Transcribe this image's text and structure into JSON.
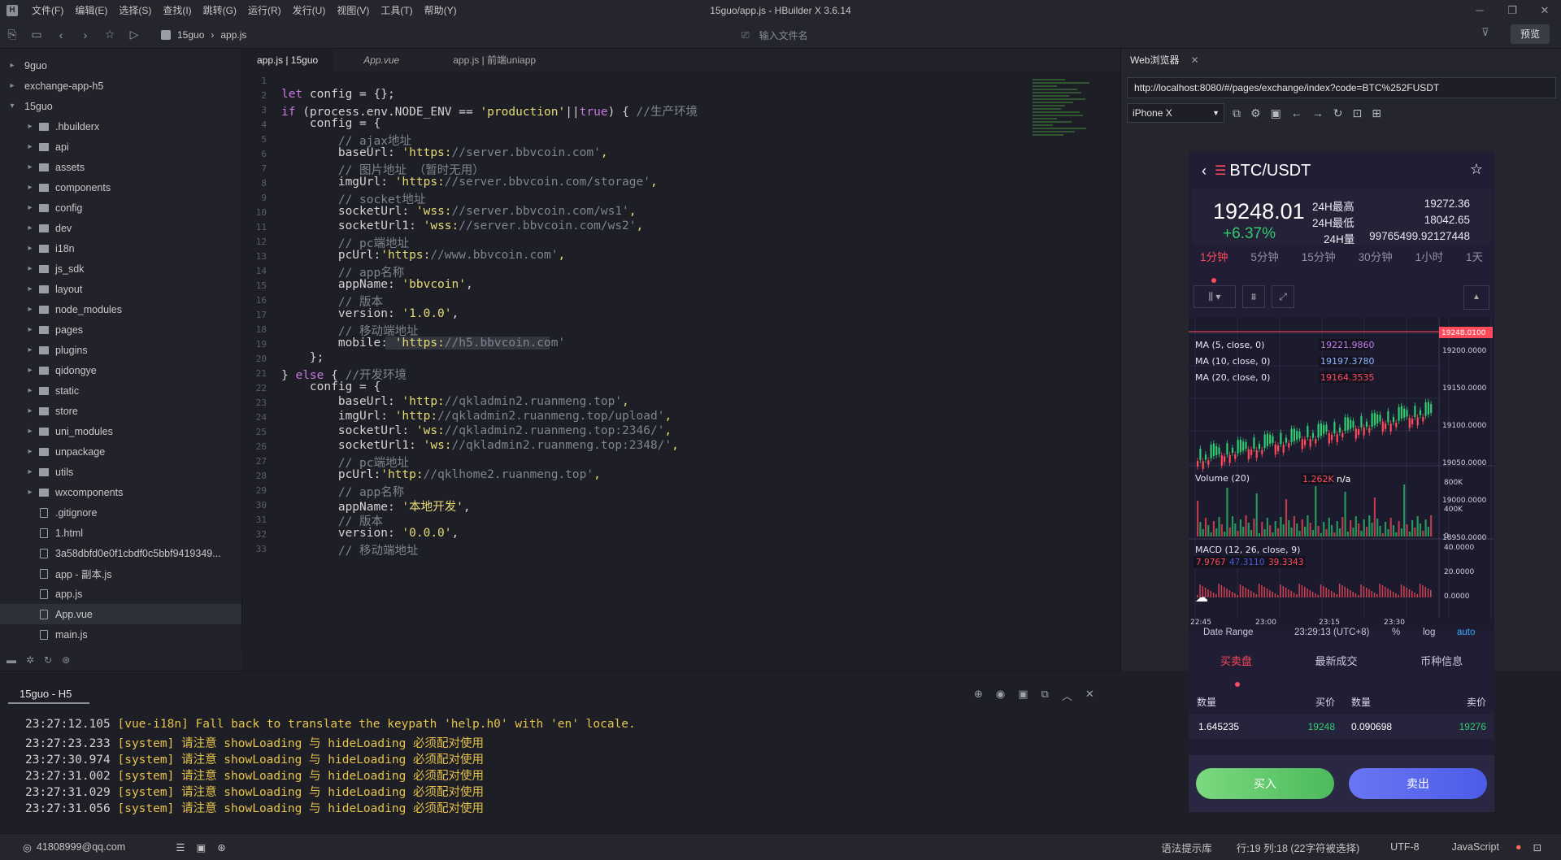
{
  "app": {
    "window_title": "15guo/app.js - HBuilder X 3.6.14",
    "menu": [
      "文件(F)",
      "编辑(E)",
      "选择(S)",
      "查找(I)",
      "跳转(G)",
      "运行(R)",
      "发行(U)",
      "视图(V)",
      "工具(T)",
      "帮助(Y)"
    ],
    "breadcrumb": [
      "15guo",
      "app.js"
    ],
    "search_placeholder": "输入文件名",
    "preview_label": "预览"
  },
  "sidebar": {
    "items": [
      {
        "label": "9guo",
        "type": "project",
        "level": 0
      },
      {
        "label": "exchange-app-h5",
        "type": "project",
        "level": 0
      },
      {
        "label": "15guo",
        "type": "project",
        "level": 0,
        "expanded": true
      },
      {
        "label": ".hbuilderx",
        "type": "folder",
        "level": 1
      },
      {
        "label": "api",
        "type": "folder",
        "level": 1
      },
      {
        "label": "assets",
        "type": "folder",
        "level": 1
      },
      {
        "label": "components",
        "type": "folder",
        "level": 1
      },
      {
        "label": "config",
        "type": "folder",
        "level": 1
      },
      {
        "label": "dev",
        "type": "folder",
        "level": 1
      },
      {
        "label": "i18n",
        "type": "folder",
        "level": 1
      },
      {
        "label": "js_sdk",
        "type": "folder",
        "level": 1
      },
      {
        "label": "layout",
        "type": "folder",
        "level": 1
      },
      {
        "label": "node_modules",
        "type": "folder",
        "level": 1
      },
      {
        "label": "pages",
        "type": "folder",
        "level": 1
      },
      {
        "label": "plugins",
        "type": "folder",
        "level": 1
      },
      {
        "label": "qidongye",
        "type": "folder",
        "level": 1
      },
      {
        "label": "static",
        "type": "folder",
        "level": 1
      },
      {
        "label": "store",
        "type": "folder",
        "level": 1
      },
      {
        "label": "uni_modules",
        "type": "folder",
        "level": 1
      },
      {
        "label": "unpackage",
        "type": "folder",
        "level": 1
      },
      {
        "label": "utils",
        "type": "folder",
        "level": 1
      },
      {
        "label": "wxcomponents",
        "type": "folder",
        "level": 1
      },
      {
        "label": ".gitignore",
        "type": "file",
        "level": 1
      },
      {
        "label": "1.html",
        "type": "file",
        "level": 1
      },
      {
        "label": "3a58dbfd0e0f1cbdf0c5bbf9419349...",
        "type": "file",
        "level": 1
      },
      {
        "label": "app - 副本.js",
        "type": "file",
        "level": 1
      },
      {
        "label": "app.js",
        "type": "file",
        "level": 1
      },
      {
        "label": "App.vue",
        "type": "file",
        "level": 1,
        "selected": true
      },
      {
        "label": "main.js",
        "type": "file",
        "level": 1
      }
    ]
  },
  "tabs": [
    {
      "label": "app.js | 15guo",
      "active": true
    },
    {
      "label": "App.vue",
      "active": false
    },
    {
      "label": "app.js | 前端uniapp",
      "active": false
    }
  ],
  "code_lines": [
    "",
    "let config = {};",
    "if (process.env.NODE_ENV == 'production'||true) { //生产环境",
    "    config = {",
    "        // ajax地址",
    "        baseUrl: 'https://server.bbvcoin.com',",
    "        // 图片地址 （暂时无用）",
    "        imgUrl: 'https://server.bbvcoin.com/storage',",
    "        // socket地址",
    "        socketUrl: 'wss://server.bbvcoin.com/ws1',",
    "        socketUrl1: 'wss://server.bbvcoin.com/ws2',",
    "        // pc端地址",
    "        pcUrl:'https://www.bbvcoin.com',",
    "        // app名称",
    "        appName: 'bbvcoin',",
    "        // 版本",
    "        version: '1.0.0',",
    "        // 移动端地址",
    "        mobile: 'https://h5.bbvcoin.com'",
    "    };",
    "} else { //开发环境",
    "    config = {",
    "        baseUrl: 'http://qkladmin2.ruanmeng.top',",
    "        imgUrl: 'http://qkladmin2.ruanmeng.top/upload',",
    "        socketUrl: 'ws://qkladmin2.ruanmeng.top:2346/',",
    "        socketUrl1: 'ws://qkladmin2.ruanmeng.top:2348/',",
    "        // pc端地址",
    "        pcUrl:'http://qklhome2.ruanmeng.top',",
    "        // app名称",
    "        appName: '本地开发',",
    "        // 版本",
    "        version: '0.0.0',",
    "        // 移动端地址"
  ],
  "browser": {
    "tab_label": "Web浏览器",
    "url": "http://localhost:8080/#/pages/exchange/index?code=BTC%252FUSDT",
    "device": "iPhone X"
  },
  "phone": {
    "pair": "BTC/USDT",
    "price": "19248.01",
    "change": "+6.37%",
    "stats": [
      {
        "label": "24H最高",
        "value": "19272.36"
      },
      {
        "label": "24H最低",
        "value": "18042.65"
      },
      {
        "label": "24H量",
        "value": "99765499.92127448"
      }
    ],
    "intervals": [
      "1分钟",
      "5分钟",
      "15分钟",
      "30分钟",
      "1小时",
      "1天"
    ],
    "active_interval": 0,
    "chart": {
      "last_price_tag": "19248.0100",
      "ma": [
        {
          "label": "MA (5, close, 0)",
          "value": "19221.9860",
          "color": "#c07ee8"
        },
        {
          "label": "MA (10, close, 0)",
          "value": "19197.3780",
          "color": "#8fb5ff"
        },
        {
          "label": "MA (20, close, 0)",
          "value": "19164.3535",
          "color": "#ff4a5c"
        }
      ],
      "price_ticks": [
        "19200.0000",
        "19150.0000",
        "19100.0000",
        "19050.0000",
        "19000.0000",
        "18950.0000"
      ],
      "volume_label": "Volume (20)",
      "volume_value": "1.262K",
      "volume_na": "n/a",
      "volume_ticks": [
        "800K",
        "400K",
        "0"
      ],
      "macd_label": "MACD (12, 26, close, 9)",
      "macd_values": [
        "7.9767",
        "47.3110",
        "39.3343"
      ],
      "macd_ticks": [
        "40.0000",
        "20.0000",
        "0.0000"
      ],
      "time_ticks": [
        "22:45",
        "23:00",
        "23:15",
        "23:30"
      ],
      "date_range": "Date Range",
      "time_now": "23:29:13 (UTC+8)",
      "pct": "%",
      "log": "log",
      "auto": "auto"
    },
    "ob_tabs": [
      "买卖盘",
      "最新成交",
      "币种信息"
    ],
    "ob_headers": [
      "数量",
      "买价",
      "数量",
      "卖价"
    ],
    "ob_row": {
      "bid_qty": "1.645235",
      "bid_price": "19248",
      "ask_qty": "0.090698",
      "ask_price": "19276"
    },
    "buy_label": "买入",
    "sell_label": "卖出"
  },
  "console": {
    "tab_label": "15guo - H5",
    "lines": [
      {
        "time": "23:27:12.105",
        "text": " [vue-i18n] Fall back to translate the keypath 'help.h0' with 'en' locale."
      },
      {
        "time": "23:27:23.233",
        "text": " [system] 请注意 showLoading 与 hideLoading 必须配对使用"
      },
      {
        "time": "23:27:30.974",
        "text": " [system] 请注意 showLoading 与 hideLoading 必须配对使用"
      },
      {
        "time": "23:27:31.002",
        "text": " [system] 请注意 showLoading 与 hideLoading 必须配对使用"
      },
      {
        "time": "23:27:31.029",
        "text": " [system] 请注意 showLoading 与 hideLoading 必须配对使用"
      },
      {
        "time": "23:27:31.056",
        "text": " [system] 请注意 showLoading 与 hideLoading 必须配对使用"
      }
    ]
  },
  "status": {
    "user": "41808999@qq.com",
    "hint": "语法提示库",
    "position": "行:19  列:18 (22字符被选择)",
    "encoding": "UTF-8",
    "language": "JavaScript"
  },
  "colors": {
    "accent_red": "#ff4a5c",
    "accent_green": "#2ecc71",
    "buy_green": "#5cc86b",
    "sell_blue": "#5b6cf0"
  }
}
